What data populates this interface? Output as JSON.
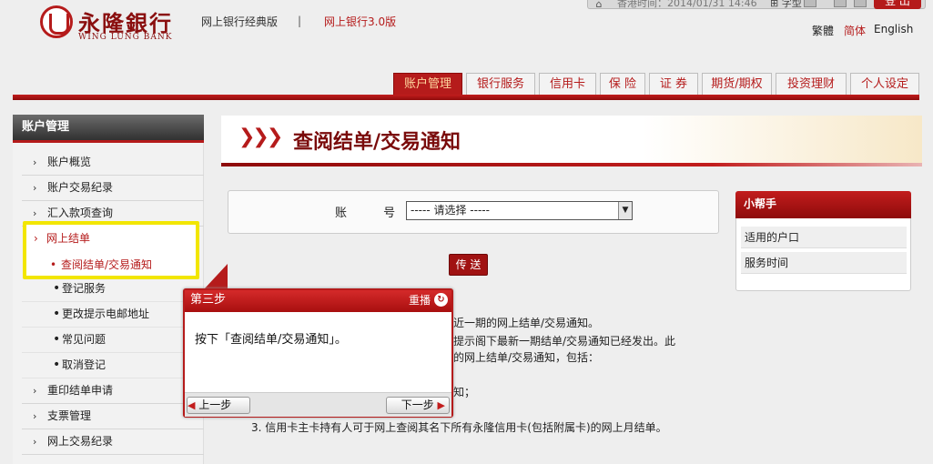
{
  "brand": {
    "name_cn": "永隆銀行",
    "name_en": "WING LUNG BANK"
  },
  "header": {
    "version_classic": "网上银行经典版",
    "separator": "|",
    "version_new": "网上银行3.0版",
    "time_text": "香港时间：2014/01/31 14:46",
    "font_size_label": "字型",
    "logout_label": "登 出",
    "languages": [
      "繁體",
      "简体",
      "English"
    ]
  },
  "nav_tabs": [
    "账户管理",
    "银行服务",
    "信用卡",
    "保 险",
    "证 券",
    "期货/期权",
    "投资理财",
    "个人设定"
  ],
  "sidebar": {
    "title": "账户管理",
    "items": [
      "账户概览",
      "账户交易纪录",
      "汇入款项查询",
      "网上结单",
      "查阅结单/交易通知",
      "登记服务",
      "更改提示电邮地址",
      "常见问题",
      "取消登记",
      "重印结单申请",
      "支票管理",
      "网上交易纪录"
    ]
  },
  "main": {
    "title": "查阅结单/交易通知",
    "account_label": "账 号:",
    "account_select": "----- 请选择 -----",
    "send_label": "传 送",
    "body_lines": [
      "近一期的网上结单/交易通知。",
      "提示阁下最新一期结单/交易通知已经发出。此",
      "的网上结单/交易通知，包括：",
      "知；",
      "3.   信用卡主卡持有人可于网上查阅其名下所有永隆信用卡(包括附属卡)的网上月结单。"
    ]
  },
  "helper": {
    "title": "小帮手",
    "items": [
      "适用的户口",
      "服务时间"
    ]
  },
  "tutorial": {
    "step_title": "第三步",
    "replay_label": "重播",
    "instruction": "按下「查阅结单/交易通知」。",
    "prev_label": "上一步",
    "next_label": "下一步"
  },
  "colors": {
    "brand_red": "#b51b1b",
    "highlight_yellow": "#f2e600"
  }
}
